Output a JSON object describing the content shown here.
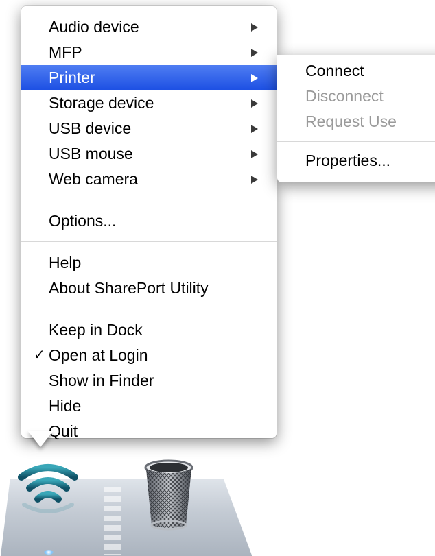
{
  "menu": {
    "groups": [
      {
        "items": [
          {
            "label": "Audio device",
            "has_submenu": true
          },
          {
            "label": "MFP",
            "has_submenu": true
          },
          {
            "label": "Printer",
            "has_submenu": true,
            "highlighted": true
          },
          {
            "label": "Storage device",
            "has_submenu": true
          },
          {
            "label": "USB device",
            "has_submenu": true
          },
          {
            "label": "USB mouse",
            "has_submenu": true
          },
          {
            "label": "Web camera",
            "has_submenu": true
          }
        ]
      },
      {
        "items": [
          {
            "label": "Options..."
          }
        ]
      },
      {
        "items": [
          {
            "label": "Help"
          },
          {
            "label": "About SharePort Utility"
          }
        ]
      },
      {
        "items": [
          {
            "label": "Keep in Dock"
          },
          {
            "label": "Open at Login",
            "checked": true
          },
          {
            "label": "Show in Finder"
          },
          {
            "label": "Hide"
          },
          {
            "label": "Quit"
          }
        ]
      }
    ]
  },
  "submenu": {
    "items": [
      {
        "label": "Connect",
        "enabled": true
      },
      {
        "label": "Disconnect",
        "enabled": false
      },
      {
        "label": "Request Use",
        "enabled": false
      },
      {
        "label": "Properties...",
        "enabled": true
      }
    ]
  },
  "check_mark": "✓",
  "dock": {
    "icons": [
      "shareport-wifi-icon",
      "trash-icon"
    ]
  },
  "colors": {
    "highlight": "#2b5ce8",
    "disabled_text": "#9a9a9a",
    "wifi_teal": "#1b6f85"
  }
}
